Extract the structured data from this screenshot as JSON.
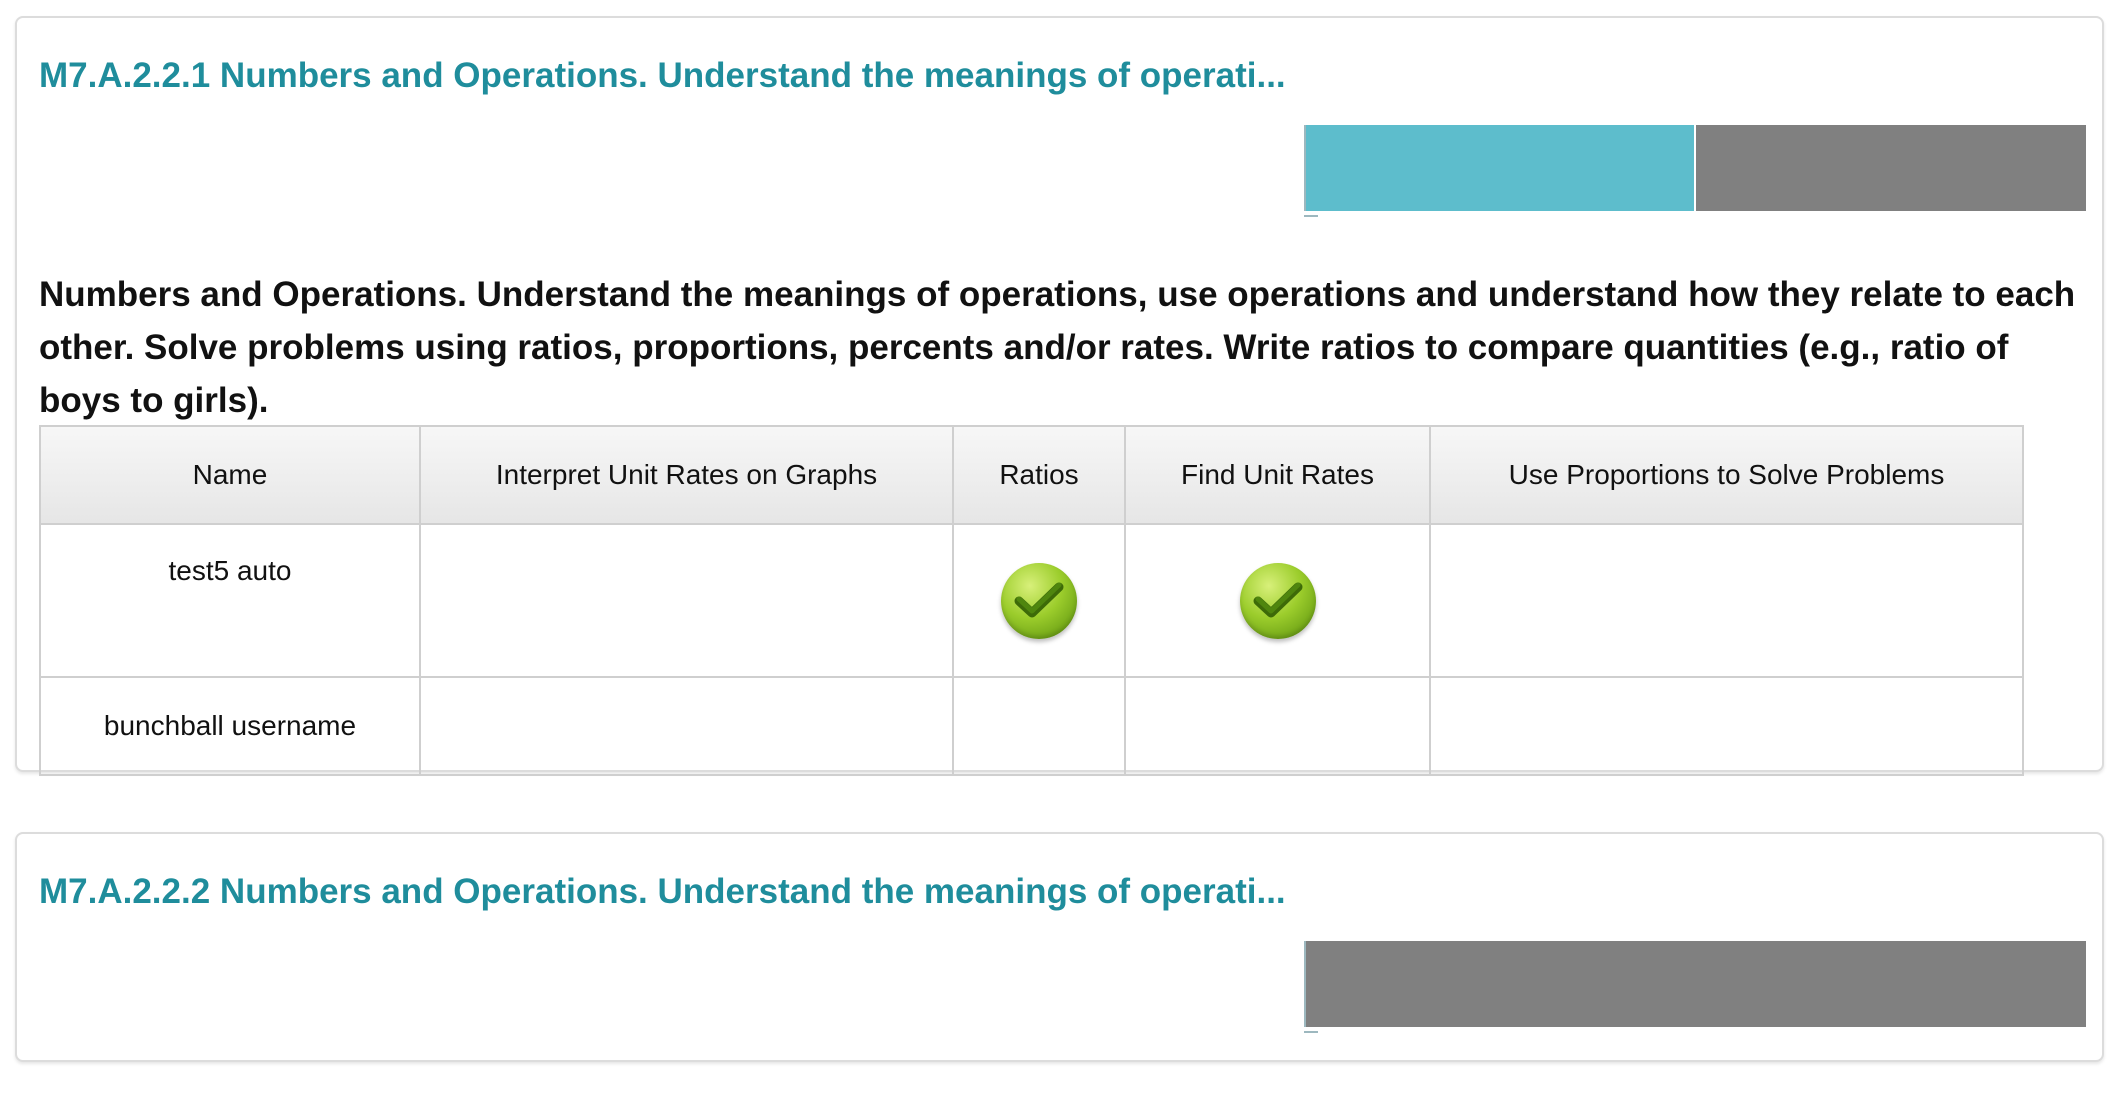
{
  "cards": [
    {
      "title": "M7.A.2.2.1 Numbers and Operations. Understand the meanings of operati...",
      "progress_fraction": 0.5,
      "description": "Numbers and Operations. Understand the meanings of operations, use operations and understand how they relate to each other. Solve problems using ratios, proportions, percents and/or rates. Write ratios to compare quantities (e.g., ratio of boys to girls).",
      "table": {
        "headers": [
          "Name",
          "Interpret Unit Rates on Graphs",
          "Ratios",
          "Find Unit Rates",
          "Use Proportions to Solve Problems"
        ],
        "rows": [
          {
            "name": "test5 auto",
            "checks": [
              false,
              true,
              true,
              false
            ]
          },
          {
            "name": "bunchball username",
            "checks": [
              false,
              false,
              false,
              false
            ]
          }
        ]
      }
    },
    {
      "title": "M7.A.2.2.2 Numbers and Operations. Understand the meanings of operati...",
      "progress_fraction": 0.0
    }
  ],
  "colors": {
    "title": "#1f8d9c",
    "progress_fill": "#5dbdcc",
    "progress_rest": "#808080",
    "check": "#8cc63f"
  },
  "icons": {
    "check": "check-circle-icon"
  }
}
